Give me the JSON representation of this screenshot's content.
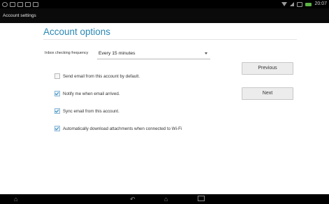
{
  "status_bar": {
    "time": "20:07",
    "left_icons": [
      "notification-icon",
      "usb-icon",
      "screenshot-icon",
      "gallery-icon",
      "app-icon"
    ],
    "right_icons": [
      "wifi-icon",
      "signal-icon",
      "data-icon",
      "battery-icon"
    ]
  },
  "action_bar": {
    "title": "Account settings"
  },
  "page": {
    "title": "Account options",
    "frequency": {
      "label": "Inbox checking frequency",
      "value": "Every 15 minutes"
    },
    "options": [
      {
        "label": "Send email from this account by default.",
        "checked": false
      },
      {
        "label": "Notify me when email arrived.",
        "checked": true
      },
      {
        "label": "Sync email from this account.",
        "checked": true
      },
      {
        "label": "Automatically download attachments when connected to Wi-Fi",
        "checked": true
      }
    ],
    "buttons": {
      "previous": "Previous",
      "next": "Next"
    }
  },
  "nav_bar": {
    "icons": [
      "asus-home-icon",
      "back-icon",
      "home-icon",
      "recent-apps-icon"
    ]
  }
}
